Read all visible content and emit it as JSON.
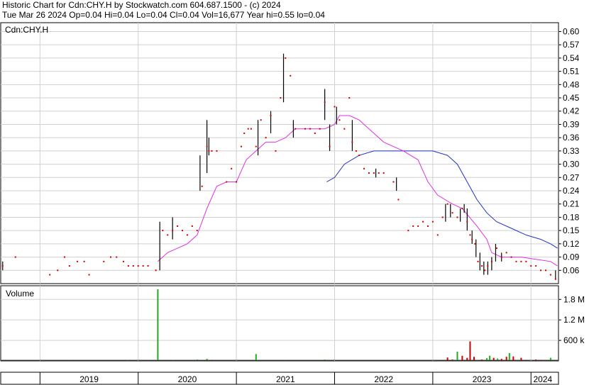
{
  "header": {
    "line1": "Historic Chart for Cdn:CHY.H by Stockwatch.com 604.687.1500 - (c) 2024",
    "line2": "Tue Mar 26 2024  Op=0.04  Hi=0.04  Lo=0.04  Cl=0.04  Vol=16,677  Year hi=0.55  lo=0.04"
  },
  "colors": {
    "price": "#cc0000",
    "range": "#000000",
    "ma_short": "#dd33dd",
    "ma_long": "#2233bb",
    "volume_up": "#22aa22",
    "volume_down": "#cc0000",
    "grid": "#d0d0d0"
  },
  "chart_data": [
    {
      "type": "scatter",
      "title": "Cdn:CHY.H",
      "ylim": [
        0.03,
        0.62
      ],
      "yticks": [
        0.06,
        0.09,
        0.12,
        0.15,
        0.18,
        0.21,
        0.24,
        0.27,
        0.3,
        0.33,
        0.36,
        0.39,
        0.42,
        0.45,
        0.48,
        0.51,
        0.54,
        0.57,
        0.6
      ],
      "xlim": [
        2018.6,
        2024.28
      ],
      "x_tick_labels": [
        "2019",
        "2020",
        "2021",
        "2022",
        "2023",
        "2024"
      ],
      "x_tick_label_pos": [
        2019.5,
        2020.5,
        2021.5,
        2022.5,
        2023.5,
        2024.12
      ],
      "year_boundaries": [
        2019.0,
        2020.0,
        2021.0,
        2022.0,
        2023.0,
        2024.0
      ],
      "grid": true,
      "series": [
        {
          "kind": "close",
          "points": [
            [
              2018.62,
              0.07
            ],
            [
              2018.75,
              0.09
            ],
            [
              2019.1,
              0.05
            ],
            [
              2019.18,
              0.06
            ],
            [
              2019.25,
              0.09
            ],
            [
              2019.3,
              0.07
            ],
            [
              2019.38,
              0.08
            ],
            [
              2019.45,
              0.08
            ],
            [
              2019.5,
              0.05
            ],
            [
              2019.65,
              0.08
            ],
            [
              2019.72,
              0.09
            ],
            [
              2019.78,
              0.09
            ],
            [
              2019.85,
              0.08
            ],
            [
              2019.9,
              0.07
            ],
            [
              2019.95,
              0.07
            ],
            [
              2020.0,
              0.07
            ],
            [
              2020.05,
              0.07
            ],
            [
              2020.1,
              0.07
            ],
            [
              2020.18,
              0.06
            ],
            [
              2020.25,
              0.15
            ],
            [
              2020.3,
              0.14
            ],
            [
              2020.35,
              0.15
            ],
            [
              2020.4,
              0.16
            ],
            [
              2020.45,
              0.15
            ],
            [
              2020.5,
              0.14
            ],
            [
              2020.55,
              0.16
            ],
            [
              2020.6,
              0.15
            ],
            [
              2020.65,
              0.25
            ],
            [
              2020.7,
              0.34
            ],
            [
              2020.72,
              0.33
            ],
            [
              2020.75,
              0.33
            ],
            [
              2020.8,
              0.33
            ],
            [
              2020.9,
              0.26
            ],
            [
              2020.95,
              0.29
            ],
            [
              2021.0,
              0.26
            ],
            [
              2021.05,
              0.34
            ],
            [
              2021.08,
              0.37
            ],
            [
              2021.12,
              0.38
            ],
            [
              2021.15,
              0.38
            ],
            [
              2021.2,
              0.34
            ],
            [
              2021.25,
              0.4
            ],
            [
              2021.3,
              0.36
            ],
            [
              2021.35,
              0.41
            ],
            [
              2021.4,
              0.33
            ],
            [
              2021.45,
              0.45
            ],
            [
              2021.5,
              0.54
            ],
            [
              2021.55,
              0.5
            ],
            [
              2021.6,
              0.38
            ],
            [
              2021.7,
              0.38
            ],
            [
              2021.75,
              0.38
            ],
            [
              2021.8,
              0.37
            ],
            [
              2021.85,
              0.38
            ],
            [
              2021.9,
              0.44
            ],
            [
              2021.95,
              0.34
            ],
            [
              2022.0,
              0.43
            ],
            [
              2022.05,
              0.4
            ],
            [
              2022.1,
              0.38
            ],
            [
              2022.15,
              0.45
            ],
            [
              2022.18,
              0.35
            ],
            [
              2022.22,
              0.33
            ],
            [
              2022.25,
              0.32
            ],
            [
              2022.3,
              0.29
            ],
            [
              2022.35,
              0.28
            ],
            [
              2022.4,
              0.28
            ],
            [
              2022.45,
              0.28
            ],
            [
              2022.5,
              0.28
            ],
            [
              2022.6,
              0.26
            ],
            [
              2022.65,
              0.22
            ],
            [
              2022.75,
              0.15
            ],
            [
              2022.8,
              0.16
            ],
            [
              2022.85,
              0.16
            ],
            [
              2022.9,
              0.17
            ],
            [
              2022.95,
              0.16
            ],
            [
              2023.0,
              0.17
            ],
            [
              2023.05,
              0.14
            ],
            [
              2023.1,
              0.18
            ],
            [
              2023.15,
              0.21
            ],
            [
              2023.2,
              0.19
            ],
            [
              2023.25,
              0.18
            ],
            [
              2023.3,
              0.2
            ],
            [
              2023.35,
              0.17
            ],
            [
              2023.38,
              0.14
            ],
            [
              2023.4,
              0.13
            ],
            [
              2023.43,
              0.12
            ],
            [
              2023.46,
              0.08
            ],
            [
              2023.5,
              0.07
            ],
            [
              2023.53,
              0.06
            ],
            [
              2023.56,
              0.07
            ],
            [
              2023.6,
              0.08
            ],
            [
              2023.65,
              0.11
            ],
            [
              2023.7,
              0.09
            ],
            [
              2023.75,
              0.1
            ],
            [
              2023.8,
              0.09
            ],
            [
              2023.85,
              0.08
            ],
            [
              2023.9,
              0.08
            ],
            [
              2023.95,
              0.08
            ],
            [
              2024.0,
              0.07
            ],
            [
              2024.05,
              0.07
            ],
            [
              2024.1,
              0.06
            ],
            [
              2024.15,
              0.06
            ],
            [
              2024.2,
              0.05
            ],
            [
              2024.25,
              0.04
            ]
          ]
        },
        {
          "kind": "high_low",
          "bars": [
            [
              2018.62,
              0.06,
              0.08
            ],
            [
              2020.22,
              0.06,
              0.17
            ],
            [
              2020.35,
              0.13,
              0.18
            ],
            [
              2020.63,
              0.24,
              0.32
            ],
            [
              2020.7,
              0.28,
              0.4
            ],
            [
              2020.72,
              0.32,
              0.36
            ],
            [
              2021.22,
              0.32,
              0.4
            ],
            [
              2021.35,
              0.37,
              0.42
            ],
            [
              2021.48,
              0.44,
              0.55
            ],
            [
              2021.58,
              0.36,
              0.4
            ],
            [
              2021.9,
              0.4,
              0.47
            ],
            [
              2021.95,
              0.33,
              0.39
            ],
            [
              2022.02,
              0.39,
              0.43
            ],
            [
              2022.18,
              0.33,
              0.4
            ],
            [
              2022.42,
              0.27,
              0.29
            ],
            [
              2022.63,
              0.24,
              0.27
            ],
            [
              2023.13,
              0.17,
              0.21
            ],
            [
              2023.18,
              0.18,
              0.21
            ],
            [
              2023.28,
              0.17,
              0.2
            ],
            [
              2023.32,
              0.19,
              0.21
            ],
            [
              2023.35,
              0.15,
              0.2
            ],
            [
              2023.4,
              0.12,
              0.15
            ],
            [
              2023.44,
              0.09,
              0.13
            ],
            [
              2023.48,
              0.06,
              0.1
            ],
            [
              2023.52,
              0.05,
              0.08
            ],
            [
              2023.56,
              0.05,
              0.08
            ],
            [
              2023.6,
              0.06,
              0.09
            ],
            [
              2023.64,
              0.08,
              0.12
            ],
            [
              2023.7,
              0.08,
              0.1
            ],
            [
              2024.25,
              0.04,
              0.06
            ]
          ]
        },
        {
          "kind": "moving_average_short",
          "points": [
            [
              2020.2,
              0.08
            ],
            [
              2020.3,
              0.1
            ],
            [
              2020.5,
              0.12
            ],
            [
              2020.6,
              0.14
            ],
            [
              2020.7,
              0.2
            ],
            [
              2020.8,
              0.25
            ],
            [
              2020.9,
              0.26
            ],
            [
              2021.0,
              0.26
            ],
            [
              2021.1,
              0.31
            ],
            [
              2021.2,
              0.33
            ],
            [
              2021.3,
              0.35
            ],
            [
              2021.4,
              0.35
            ],
            [
              2021.5,
              0.36
            ],
            [
              2021.6,
              0.38
            ],
            [
              2021.75,
              0.38
            ],
            [
              2021.9,
              0.38
            ],
            [
              2022.0,
              0.39
            ],
            [
              2022.05,
              0.41
            ],
            [
              2022.15,
              0.41
            ],
            [
              2022.25,
              0.4
            ],
            [
              2022.35,
              0.38
            ],
            [
              2022.5,
              0.35
            ],
            [
              2022.7,
              0.33
            ],
            [
              2022.85,
              0.31
            ],
            [
              2022.95,
              0.26
            ],
            [
              2023.05,
              0.23
            ],
            [
              2023.2,
              0.21
            ],
            [
              2023.3,
              0.2
            ],
            [
              2023.45,
              0.16
            ],
            [
              2023.55,
              0.13
            ],
            [
              2023.6,
              0.1
            ],
            [
              2023.7,
              0.09
            ],
            [
              2023.9,
              0.09
            ],
            [
              2024.05,
              0.085
            ],
            [
              2024.2,
              0.08
            ],
            [
              2024.27,
              0.07
            ]
          ]
        },
        {
          "kind": "moving_average_long",
          "points": [
            [
              2021.92,
              0.26
            ],
            [
              2022.0,
              0.27
            ],
            [
              2022.1,
              0.3
            ],
            [
              2022.25,
              0.32
            ],
            [
              2022.4,
              0.33
            ],
            [
              2022.6,
              0.33
            ],
            [
              2022.8,
              0.33
            ],
            [
              2023.0,
              0.33
            ],
            [
              2023.15,
              0.32
            ],
            [
              2023.25,
              0.3
            ],
            [
              2023.35,
              0.26
            ],
            [
              2023.45,
              0.22
            ],
            [
              2023.55,
              0.19
            ],
            [
              2023.65,
              0.17
            ],
            [
              2023.8,
              0.155
            ],
            [
              2023.95,
              0.14
            ],
            [
              2024.1,
              0.13
            ],
            [
              2024.2,
              0.12
            ],
            [
              2024.27,
              0.11
            ]
          ]
        }
      ]
    },
    {
      "type": "bar",
      "title": "Volume",
      "ylim": [
        0,
        2200000
      ],
      "yticks": [
        600000,
        1200000,
        1800000
      ],
      "ytick_labels": [
        "600 k",
        "1.2 M",
        "1.8 M"
      ],
      "bars": [
        [
          2018.7,
          20000,
          "up"
        ],
        [
          2019.3,
          15000,
          "up"
        ],
        [
          2019.7,
          18000,
          "up"
        ],
        [
          2019.9,
          12000,
          "up"
        ],
        [
          2020.2,
          2100000,
          "up"
        ],
        [
          2020.35,
          30000,
          "up"
        ],
        [
          2020.6,
          40000,
          "up"
        ],
        [
          2020.7,
          60000,
          "up"
        ],
        [
          2020.75,
          30000,
          "down"
        ],
        [
          2021.0,
          20000,
          "up"
        ],
        [
          2021.2,
          200000,
          "up"
        ],
        [
          2021.5,
          30000,
          "up"
        ],
        [
          2021.6,
          25000,
          "down"
        ],
        [
          2021.9,
          40000,
          "up"
        ],
        [
          2022.2,
          20000,
          "up"
        ],
        [
          2022.6,
          25000,
          "down"
        ],
        [
          2022.9,
          15000,
          "up"
        ],
        [
          2023.1,
          30000,
          "down"
        ],
        [
          2023.15,
          100000,
          "down"
        ],
        [
          2023.2,
          40000,
          "down"
        ],
        [
          2023.25,
          270000,
          "up"
        ],
        [
          2023.3,
          150000,
          "down"
        ],
        [
          2023.35,
          90000,
          "down"
        ],
        [
          2023.38,
          570000,
          "down"
        ],
        [
          2023.42,
          120000,
          "down"
        ],
        [
          2023.45,
          30000,
          "up"
        ],
        [
          2023.5,
          40000,
          "down"
        ],
        [
          2023.55,
          80000,
          "up"
        ],
        [
          2023.58,
          150000,
          "up"
        ],
        [
          2023.62,
          90000,
          "down"
        ],
        [
          2023.66,
          70000,
          "up"
        ],
        [
          2023.7,
          60000,
          "down"
        ],
        [
          2023.75,
          120000,
          "down"
        ],
        [
          2023.78,
          230000,
          "up"
        ],
        [
          2023.82,
          130000,
          "down"
        ],
        [
          2023.9,
          90000,
          "down"
        ],
        [
          2023.95,
          30000,
          "down"
        ],
        [
          2024.0,
          20000,
          "up"
        ],
        [
          2024.05,
          40000,
          "down"
        ],
        [
          2024.1,
          30000,
          "down"
        ],
        [
          2024.2,
          90000,
          "up"
        ],
        [
          2024.25,
          20000,
          "down"
        ]
      ]
    }
  ]
}
